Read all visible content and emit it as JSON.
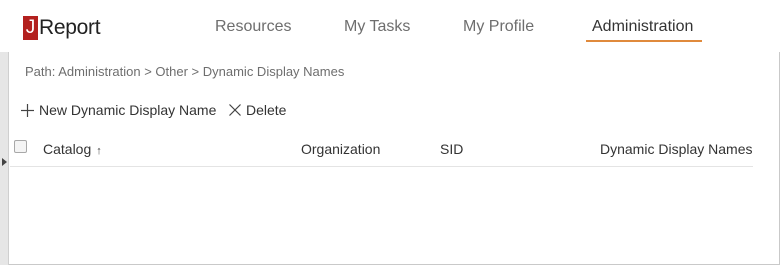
{
  "logo": {
    "mark": "J",
    "text": "Report"
  },
  "nav": {
    "items": [
      {
        "label": "Resources"
      },
      {
        "label": "My Tasks"
      },
      {
        "label": "My Profile"
      },
      {
        "label": "Administration"
      }
    ],
    "active": "Administration"
  },
  "breadcrumb": "Path: Administration > Other > Dynamic Display Names",
  "toolbar": {
    "new_label": "New Dynamic Display Name",
    "delete_label": "Delete"
  },
  "table": {
    "columns": [
      {
        "label": "Catalog",
        "sort": "ascending"
      },
      {
        "label": "Organization"
      },
      {
        "label": "SID"
      },
      {
        "label": "Dynamic Display Names"
      }
    ],
    "rows": []
  },
  "colors": {
    "brand": "#b3201e",
    "active_underline": "#e08a3c"
  },
  "icons": {
    "sort": "arrow-up-icon",
    "new": "plus-icon",
    "delete": "close-icon",
    "rail": "caret-right-icon"
  }
}
